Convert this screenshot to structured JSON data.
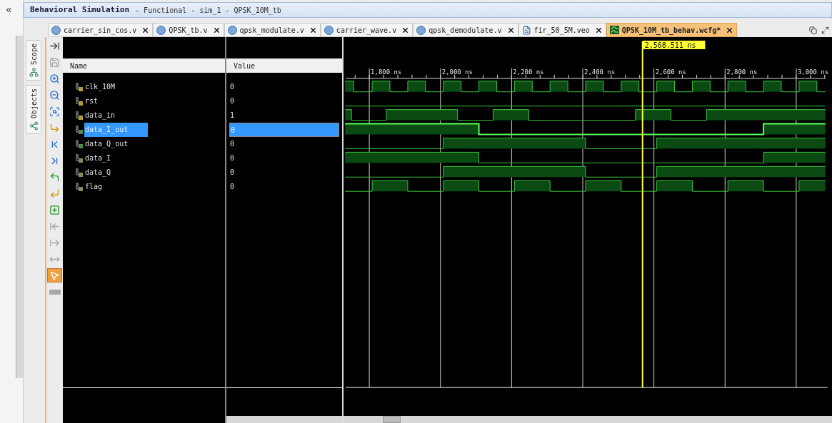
{
  "left_panel": {
    "collapse": "«"
  },
  "title_bar": {
    "title": "Behavioral Simulation",
    "subtitle": "- Functional - sim_1 - QPSK_10M_tb"
  },
  "tabs": [
    {
      "label": "carrier_sin_cos.v",
      "kind": "verilog",
      "selected": false
    },
    {
      "label": "QPSK_tb.v",
      "kind": "verilog",
      "selected": false
    },
    {
      "label": "qpsk_modulate.v",
      "kind": "verilog",
      "selected": false
    },
    {
      "label": "carrier_wave.v",
      "kind": "verilog",
      "selected": false
    },
    {
      "label": "qpsk_demodulate.v",
      "kind": "verilog",
      "selected": false
    },
    {
      "label": "fir_50_5M.veo",
      "kind": "document",
      "selected": false
    },
    {
      "label": "QPSK_10M_tb_behav.wcfg*",
      "kind": "waveform",
      "selected": true
    }
  ],
  "side_tabs": [
    {
      "label": "Scope",
      "kind": "hierarchy"
    },
    {
      "label": "Objects",
      "kind": "objects"
    }
  ],
  "toolbar": [
    {
      "kind": "zoom-fit",
      "disabled": false,
      "active": false
    },
    {
      "kind": "save",
      "disabled": true,
      "active": false
    },
    {
      "kind": "zoom-in",
      "disabled": false,
      "active": false
    },
    {
      "kind": "zoom-out",
      "disabled": false,
      "active": false
    },
    {
      "kind": "zoom-area",
      "disabled": false,
      "active": false
    },
    {
      "kind": "go-to-cursor",
      "disabled": false,
      "active": false
    },
    {
      "kind": "go-to-start",
      "disabled": false,
      "active": false
    },
    {
      "kind": "go-to-end",
      "disabled": false,
      "active": false
    },
    {
      "kind": "previous-transition",
      "disabled": false,
      "active": false
    },
    {
      "kind": "next-transition",
      "disabled": false,
      "active": false
    },
    {
      "kind": "add-marker",
      "disabled": false,
      "active": false
    },
    {
      "kind": "previous-marker",
      "disabled": true,
      "active": false
    },
    {
      "kind": "next-marker",
      "disabled": true,
      "active": false
    },
    {
      "kind": "swap-cursors",
      "disabled": true,
      "active": false
    },
    {
      "kind": "snap",
      "disabled": false,
      "active": true
    },
    {
      "kind": "floating-ruler",
      "disabled": true,
      "active": false
    }
  ],
  "columns": [
    "Name",
    "Value"
  ],
  "signals": [
    {
      "name": "clk_10M",
      "value": "0",
      "kind": "input",
      "selected": false
    },
    {
      "name": "rst",
      "value": "0",
      "kind": "input",
      "selected": false
    },
    {
      "name": "data_in",
      "value": "1",
      "kind": "input",
      "selected": false
    },
    {
      "name": "data_I_out",
      "value": "0",
      "kind": "output",
      "selected": true
    },
    {
      "name": "data_Q_out",
      "value": "0",
      "kind": "output",
      "selected": false
    },
    {
      "name": "data_I",
      "value": "0",
      "kind": "internal",
      "selected": false
    },
    {
      "name": "data_Q",
      "value": "0",
      "kind": "internal",
      "selected": false
    },
    {
      "name": "flag",
      "value": "0",
      "kind": "internal",
      "selected": false
    }
  ],
  "cursor": {
    "time": "2,568.511 ns"
  },
  "ruler": [
    "1,800 ns",
    "2,000 ns",
    "2,200 ns",
    "2,400 ns",
    "2,600 ns",
    "2,800 ns",
    "3,000 ns"
  ]
}
